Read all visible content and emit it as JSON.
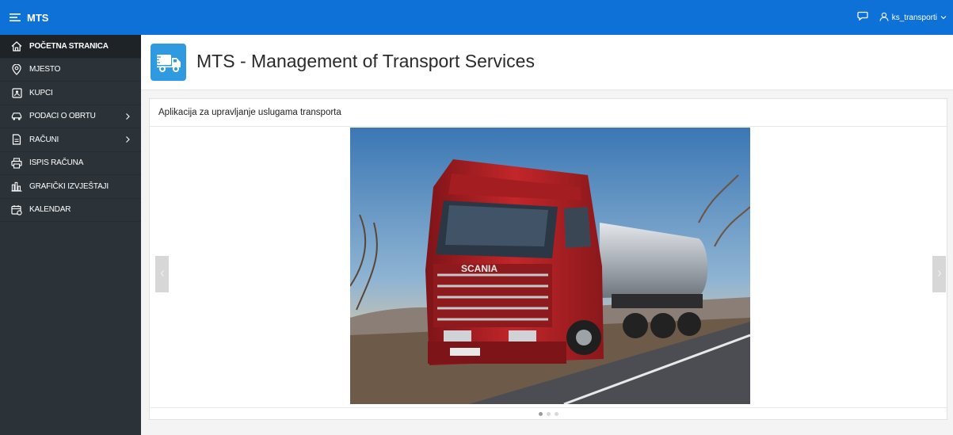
{
  "app": {
    "title": "MTS"
  },
  "topbar": {
    "username": "ks_transporti"
  },
  "sidebar": {
    "items": [
      {
        "label": "POČETNA STRANICA",
        "icon": "home-icon"
      },
      {
        "label": "MJESTO",
        "icon": "map-pin-icon"
      },
      {
        "label": "KUPCI",
        "icon": "contact-card-icon"
      },
      {
        "label": "PODACI O OBRTU",
        "icon": "car-icon",
        "has_submenu": true
      },
      {
        "label": "RAČUNI",
        "icon": "document-icon",
        "has_submenu": true
      },
      {
        "label": "ISPIS RAČUNA",
        "icon": "printer-icon"
      },
      {
        "label": "GRAFIČKI IZVJEŠTAJI",
        "icon": "bar-chart-icon"
      },
      {
        "label": "KALENDAR",
        "icon": "calendar-icon"
      }
    ]
  },
  "page": {
    "title": "MTS - Management of Transport Services"
  },
  "panel": {
    "title": "Aplikacija za upravljanje uslugama transporta",
    "carousel": {
      "slides": 3,
      "active_slide": 1,
      "truck_brand": "SCANIA"
    }
  },
  "colors": {
    "topbar": "#0e71d8",
    "sidebar": "#2c3338",
    "hero_icon": "#2f9ae0"
  }
}
